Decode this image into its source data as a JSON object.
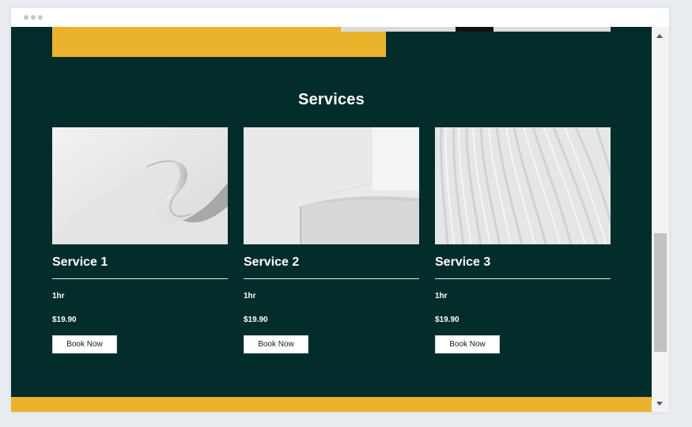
{
  "section": {
    "title": "Services"
  },
  "services": [
    {
      "title": "Service 1",
      "duration": "1hr",
      "price": "$19.90",
      "button": "Book Now",
      "image": "abstract-white-ribbon"
    },
    {
      "title": "Service 2",
      "duration": "1hr",
      "price": "$19.90",
      "button": "Book Now",
      "image": "abstract-white-corner"
    },
    {
      "title": "Service 3",
      "duration": "1hr",
      "price": "$19.90",
      "button": "Book Now",
      "image": "abstract-white-waves"
    }
  ],
  "colors": {
    "background": "#022d2b",
    "accent": "#ebb32c",
    "text": "#ffffff"
  },
  "icons": {
    "scroll_up": "chevron-up-icon",
    "scroll_down": "chevron-down-icon"
  }
}
